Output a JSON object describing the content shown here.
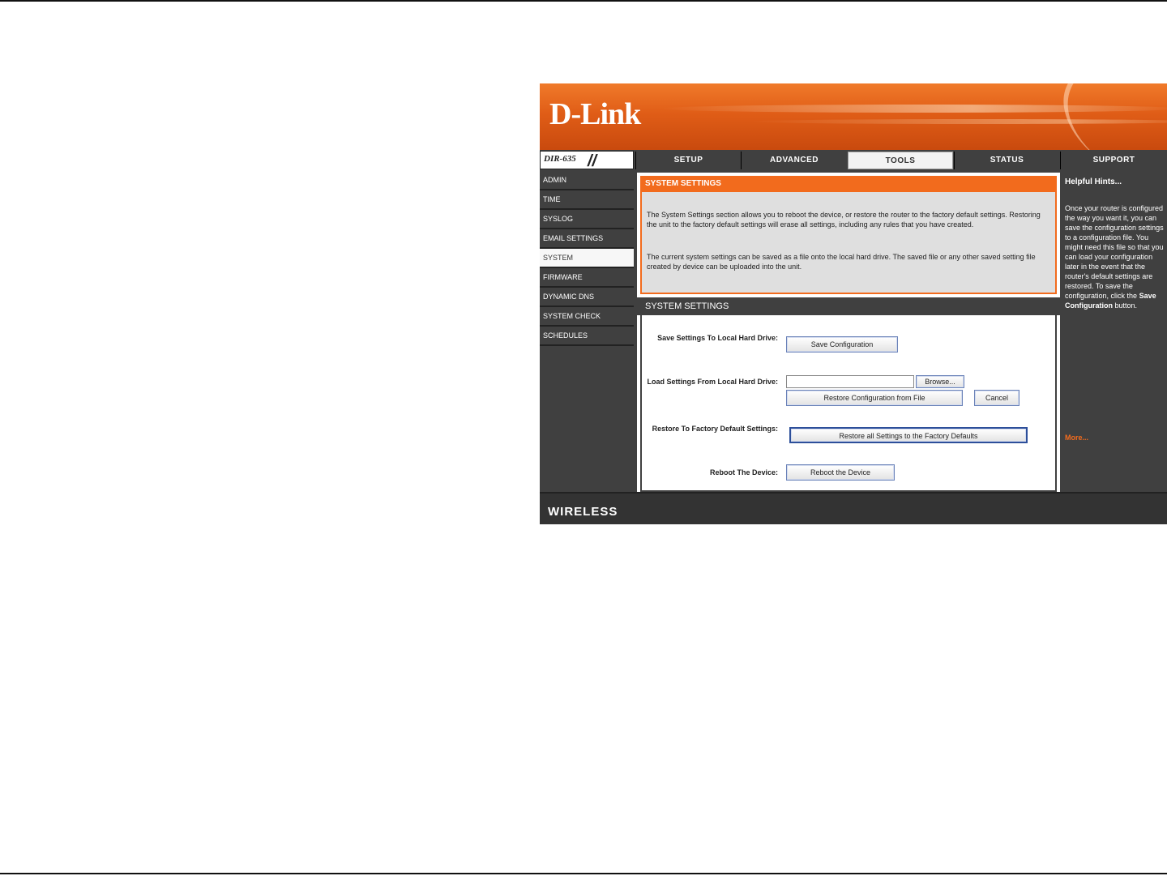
{
  "brand": {
    "logo": "D-Link",
    "model": "DIR-635"
  },
  "tabs": [
    {
      "label": "SETUP"
    },
    {
      "label": "ADVANCED"
    },
    {
      "label": "TOOLS"
    },
    {
      "label": "STATUS"
    },
    {
      "label": "SUPPORT"
    }
  ],
  "sidebar": {
    "items": [
      {
        "label": "ADMIN"
      },
      {
        "label": "TIME"
      },
      {
        "label": "SYSLOG"
      },
      {
        "label": "EMAIL SETTINGS"
      },
      {
        "label": "SYSTEM"
      },
      {
        "label": "FIRMWARE"
      },
      {
        "label": "DYNAMIC DNS"
      },
      {
        "label": "SYSTEM CHECK"
      },
      {
        "label": "SCHEDULES"
      }
    ]
  },
  "main": {
    "heading": "SYSTEM SETTINGS",
    "intro1": "The System Settings section allows you to reboot the device, or restore the router to the factory default settings. Restoring the unit to the factory default settings will erase all settings, including any rules that you have created.",
    "intro2": "The current system settings can be saved as a file onto the local hard drive. The saved file or any other saved setting file created by device can be uploaded into the unit.",
    "form_heading": "SYSTEM SETTINGS",
    "save_label": "Save Settings To Local Hard Drive:",
    "save_button": "Save Configuration",
    "load_label": "Load Settings From Local Hard Drive:",
    "browse_button": "Browse...",
    "restore_file_button": "Restore Configuration from File",
    "cancel_button": "Cancel",
    "factory_label": "Restore To Factory Default Settings:",
    "factory_button": "Restore all Settings to the Factory Defaults",
    "reboot_label": "Reboot The Device:",
    "reboot_button": "Reboot the Device"
  },
  "help": {
    "title": "Helpful Hints...",
    "body": "Once your router is configured the way you want it, you can save the configuration settings to a configuration file. You might need this file so that you can load your configuration later in the event that the router's default settings are restored. To save the configuration, click the",
    "body_bold": "Save Configuration",
    "body_end": "button.",
    "more": "More..."
  },
  "footer": {
    "brand": "WIRELESS"
  }
}
